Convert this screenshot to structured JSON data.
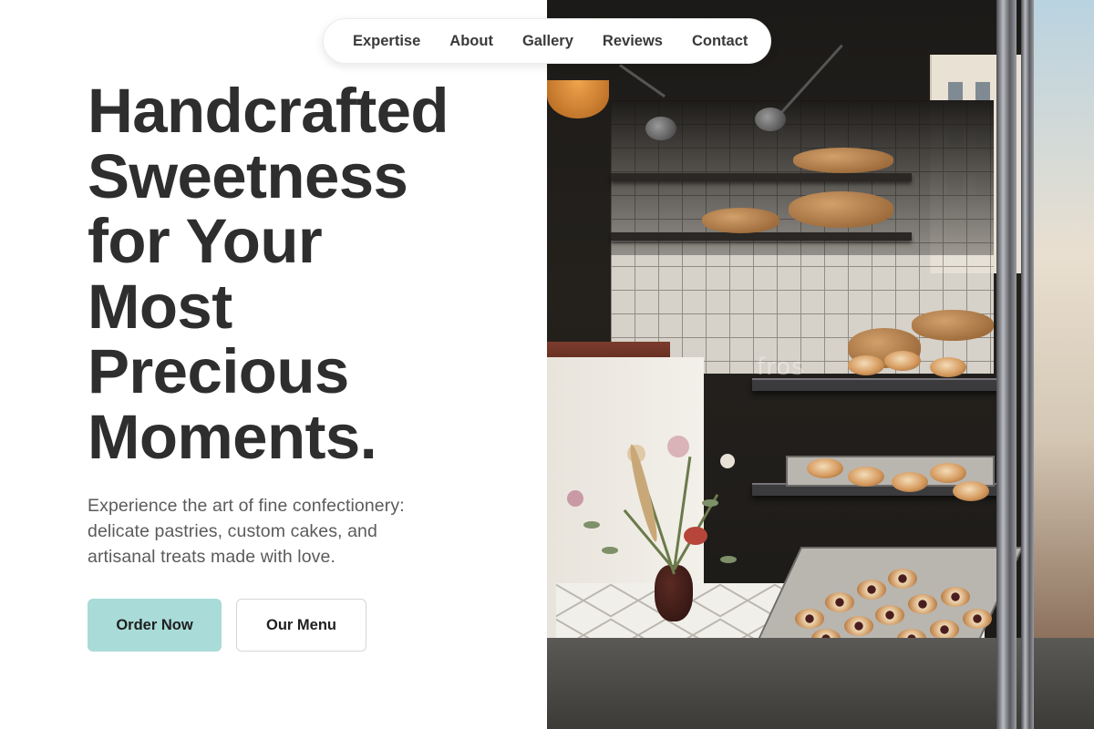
{
  "nav": {
    "items": [
      {
        "label": "Expertise"
      },
      {
        "label": "About"
      },
      {
        "label": "Gallery"
      },
      {
        "label": "Reviews"
      },
      {
        "label": "Contact"
      }
    ]
  },
  "hero": {
    "headline_lines": [
      "Handcrafted",
      "Sweetness",
      "for Your",
      "Most",
      "Precious",
      "Moments."
    ],
    "subtext_lines": [
      "Experience the art of fine confectionery:",
      "delicate pastries, custom cakes, and",
      "artisanal treats made with love."
    ],
    "primary_button": "Order Now",
    "secondary_button": "Our Menu"
  },
  "photo": {
    "watermark": "fros"
  },
  "colors": {
    "accent": "#a9dbd8",
    "text_dark": "#2e2e2e",
    "text_muted": "#5b5b5b",
    "background": "#ffffff"
  }
}
